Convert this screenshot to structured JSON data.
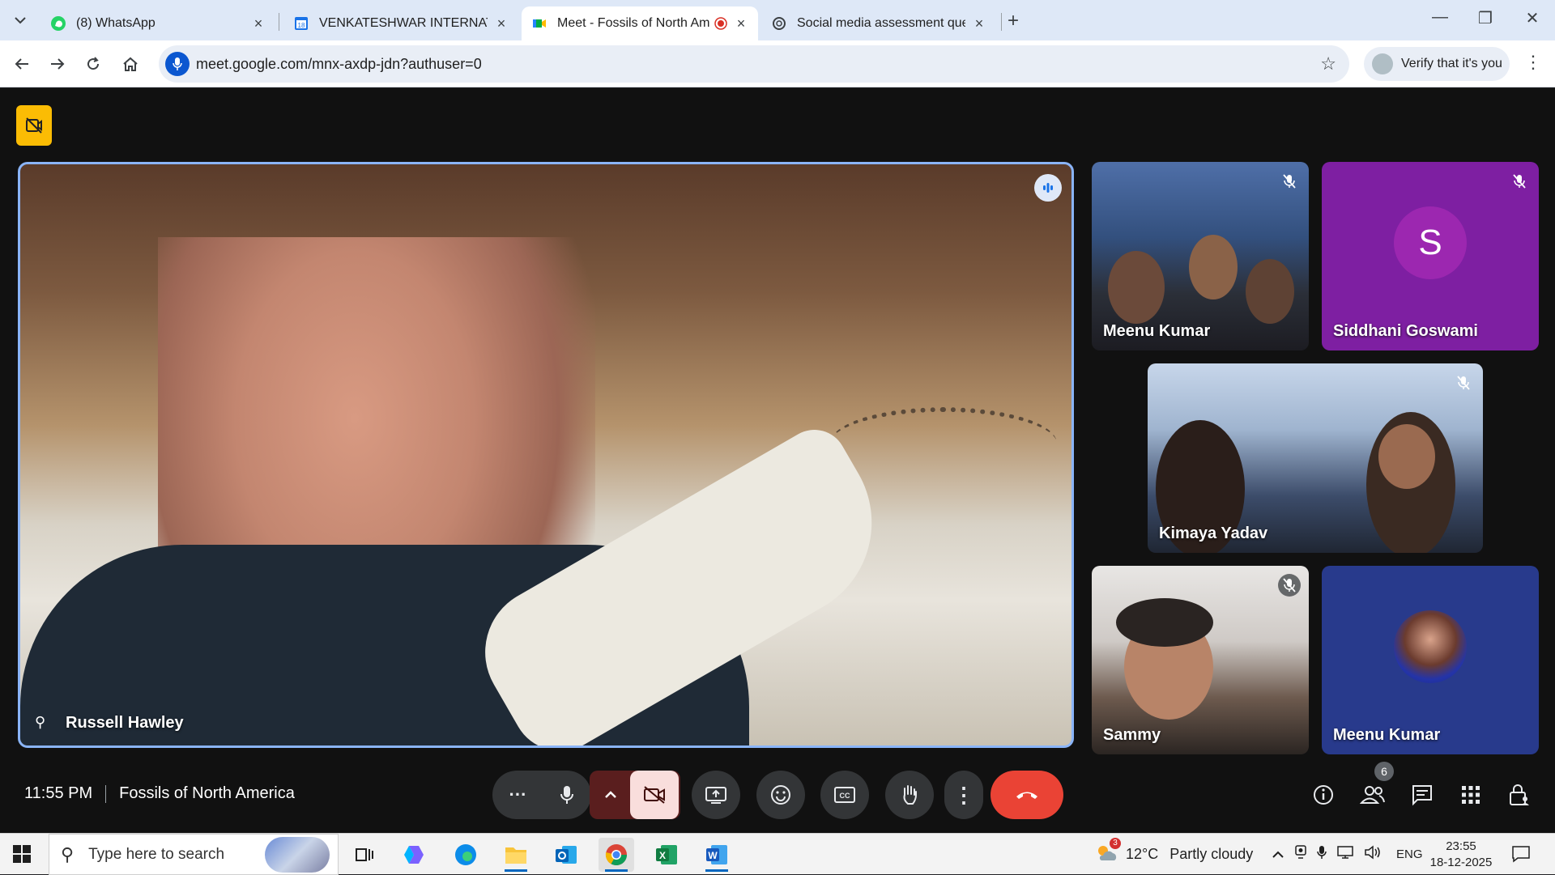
{
  "browser": {
    "tabs": [
      {
        "title": "(8) WhatsApp",
        "favicon": "whatsapp-icon",
        "active": false
      },
      {
        "title": "VENKATESHWAR INTERNATION",
        "favicon": "calendar-icon",
        "active": false
      },
      {
        "title": "Meet - Fossils of North Am",
        "favicon": "google-meet-icon",
        "active": true,
        "recording": true
      },
      {
        "title": "Social media assessment questi",
        "favicon": "openai-icon",
        "active": false
      }
    ],
    "url": "meet.google.com/mnx-axdp-jdn?authuser=0",
    "verify_label": "Verify that it's you"
  },
  "meet": {
    "main_speaker": {
      "name": "Russell Hawley",
      "speaking": true
    },
    "tiles": [
      {
        "name": "Meenu Kumar",
        "muted": true,
        "kind": "video"
      },
      {
        "name": "Siddhani Goswami",
        "muted": true,
        "kind": "avatar",
        "initial": "S"
      },
      {
        "name": "Kimaya Yadav",
        "muted": true,
        "kind": "video"
      },
      {
        "name": "Sammy",
        "muted": true,
        "kind": "video"
      },
      {
        "name": "Meenu Kumar",
        "muted": false,
        "kind": "photo"
      }
    ],
    "time": "11:55 PM",
    "meeting_title": "Fossils of North America",
    "people_count": "6",
    "colors": {
      "accent_border": "#8ab4f8",
      "end_call": "#ea4335",
      "rec_badge": "#fbbc04"
    }
  },
  "taskbar": {
    "search_placeholder": "Type here to search",
    "weather_temp": "12°C",
    "weather_text": "Partly cloudy",
    "weather_badge": "3",
    "lang": "ENG",
    "clock_time": "23:55",
    "clock_date": "18-12-2025"
  }
}
